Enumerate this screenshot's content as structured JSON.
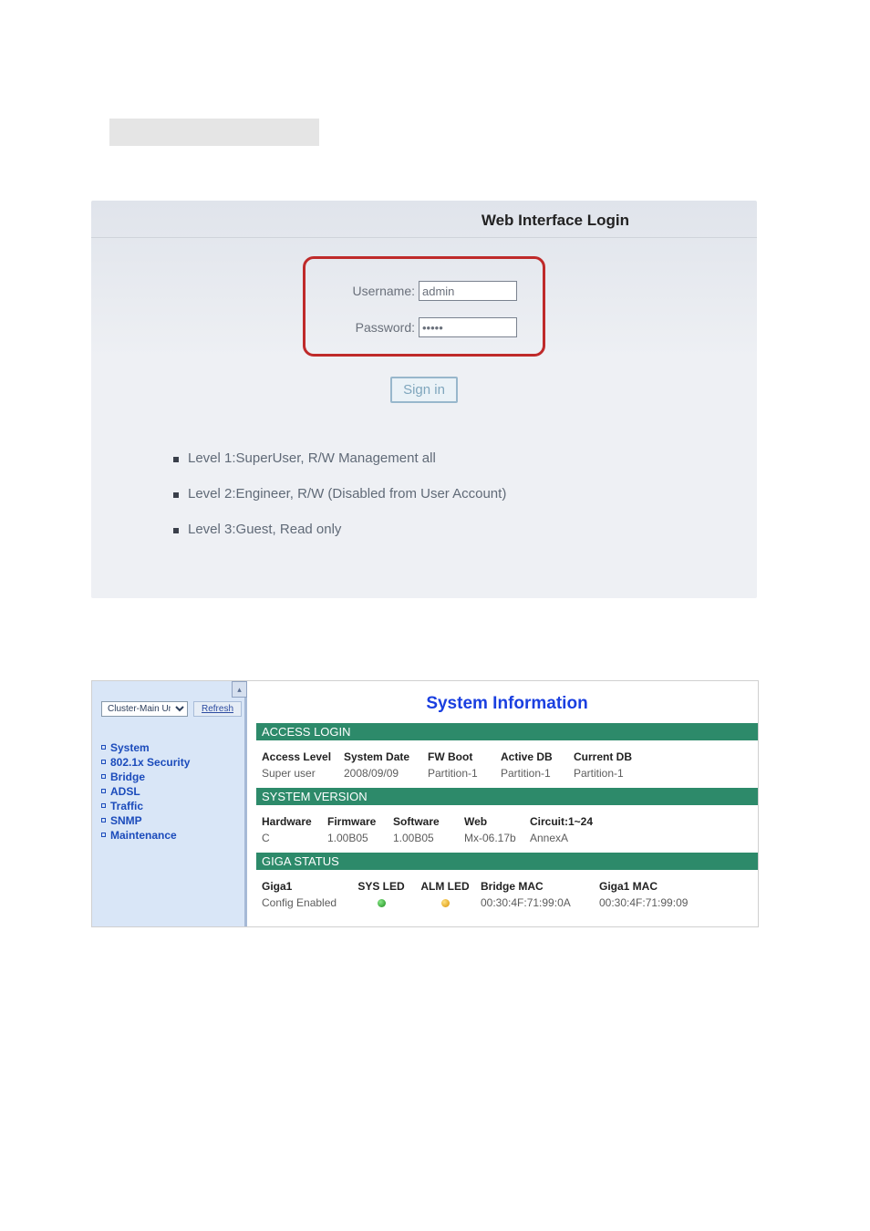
{
  "login": {
    "title": "Web Interface Login",
    "username_label": "Username:",
    "username_value": "admin",
    "password_label": "Password:",
    "password_value": "•••••",
    "signin_label": "Sign in",
    "levels": [
      "Level 1:SuperUser, R/W Management all",
      "Level 2:Engineer, R/W (Disabled from User Account)",
      "Level 3:Guest, Read only"
    ]
  },
  "sidebar": {
    "cluster_select": "Cluster-Main Unit",
    "refresh": "Refresh",
    "items": [
      "System",
      "802.1x Security",
      "Bridge",
      "ADSL",
      "Traffic",
      "SNMP",
      "Maintenance"
    ]
  },
  "sysinfo": {
    "title": "System Information",
    "access_login": {
      "section": "ACCESS LOGIN",
      "headers": [
        "Access Level",
        "System Date",
        "FW Boot",
        "Active DB",
        "Current DB"
      ],
      "values": [
        "Super user",
        "2008/09/09",
        "Partition-1",
        "Partition-1",
        "Partition-1"
      ]
    },
    "system_version": {
      "section": "SYSTEM VERSION",
      "headers": [
        "Hardware",
        "Firmware",
        "Software",
        "Web",
        "Circuit:1~24"
      ],
      "values": [
        "C",
        "1.00B05",
        "1.00B05",
        "Mx-06.17b",
        "AnnexA"
      ]
    },
    "giga_status": {
      "section": "GIGA STATUS",
      "headers": [
        "Giga1",
        "SYS LED",
        "ALM LED",
        "Bridge MAC",
        "Giga1 MAC"
      ],
      "values": [
        "Config Enabled",
        "green",
        "amber",
        "00:30:4F:71:99:0A",
        "00:30:4F:71:99:09"
      ]
    }
  }
}
